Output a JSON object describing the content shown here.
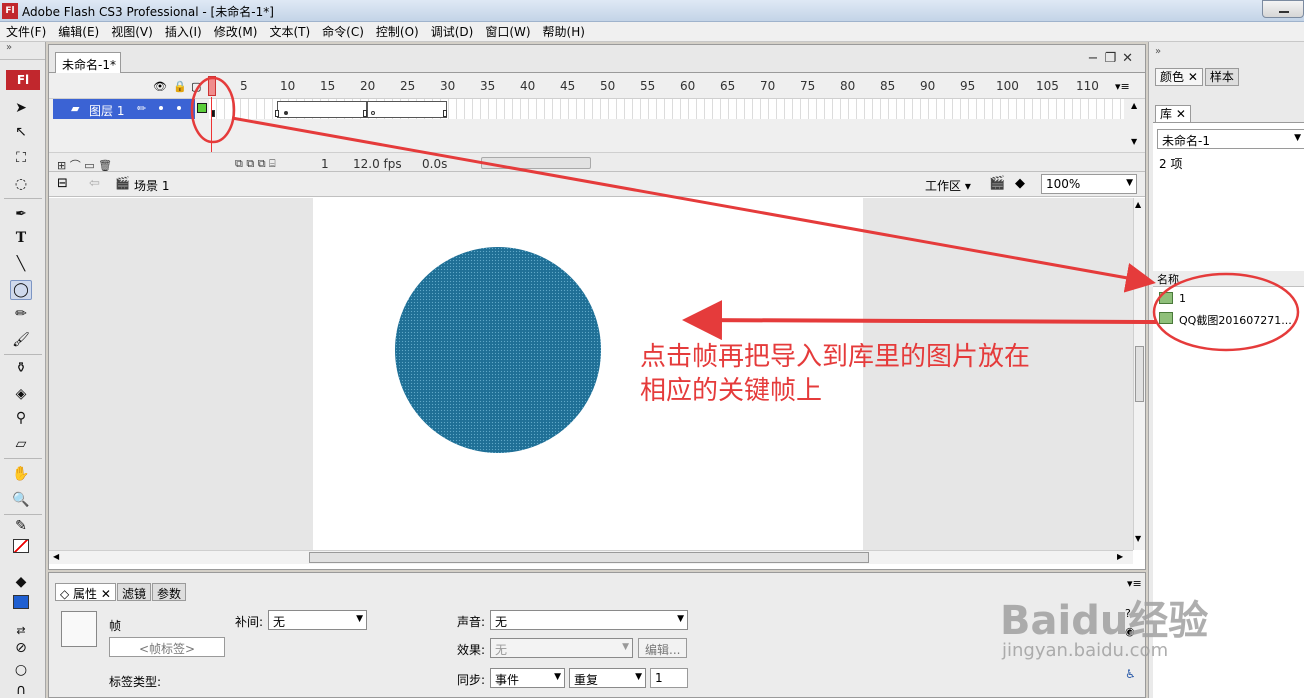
{
  "window": {
    "title": "Adobe Flash CS3 Professional - [未命名-1*]",
    "logo": "Fl"
  },
  "menu": [
    "文件(F)",
    "编辑(E)",
    "视图(V)",
    "插入(I)",
    "修改(M)",
    "文本(T)",
    "命令(C)",
    "控制(O)",
    "调试(D)",
    "窗口(W)",
    "帮助(H)"
  ],
  "toolbox": {
    "logo": "Fl"
  },
  "document": {
    "tab": "未命名-1*"
  },
  "timeline": {
    "ruler": [
      "5",
      "10",
      "15",
      "20",
      "25",
      "30",
      "35",
      "40",
      "45",
      "50",
      "55",
      "60",
      "65",
      "70",
      "75",
      "80",
      "85",
      "90",
      "95",
      "100",
      "105",
      "110"
    ],
    "layer_name": "图层 1",
    "current_frame": "1",
    "fps": "12.0 fps",
    "time": "0.0s"
  },
  "editbar": {
    "scene": "场景 1",
    "workspace": "工作区",
    "zoom": "100%"
  },
  "annotation": {
    "line1": "点击帧再把导入到库里的图片放在",
    "line2": "相应的关键帧上"
  },
  "right_panel": {
    "tabs": [
      "颜色",
      "样本"
    ],
    "library_tab": "库",
    "library_doc": "未命名-1",
    "item_count": "2 项",
    "column_name": "名称",
    "items": [
      "1",
      "QQ截图201607271..."
    ]
  },
  "properties": {
    "tabs": [
      "属性",
      "滤镜",
      "参数"
    ],
    "frame_label": "帧",
    "frame_label_placeholder": "<帧标签>",
    "label_type": "标签类型:",
    "tween_label": "补间:",
    "tween_value": "无",
    "sound_label": "声音:",
    "sound_value": "无",
    "effect_label": "效果:",
    "effect_value": "无",
    "edit_button": "编辑...",
    "sync_label": "同步:",
    "sync_value": "事件",
    "repeat_value": "重复",
    "repeat_count": "1"
  },
  "watermark": {
    "main": "Baidu经验",
    "sub": "jingyan.baidu.com"
  },
  "colors": {
    "annotation": "#e53b3b",
    "circle": "#1f6f96",
    "layer_selected": "#3b63d4"
  }
}
